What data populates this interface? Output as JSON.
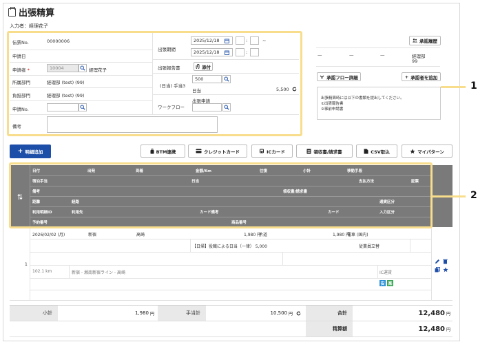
{
  "header": {
    "title": "出張精算",
    "inputter": "入力者：経理花子"
  },
  "form": {
    "denpyo_label": "伝票No.",
    "denpyo_value": "00000006",
    "shinseibi_label": "申請日",
    "shinseisha_label": "申請者",
    "shinseisha_code": "10004",
    "shinseisha_name": "経理花子",
    "shozoku_label": "所属部門",
    "shozoku_value": "経理部 (test) (99)",
    "futan_label": "負担部門",
    "futan_value": "経理部 (test) (99)",
    "shinsei_no_label": "申請No.",
    "biko_label": "備考",
    "kikan_label": "出張期間",
    "date_from": "2025/12/18",
    "date_to": "2025/12/18",
    "tilde": "~",
    "colon": ":",
    "houkokusho_label": "出張報告書",
    "attach_label": "添付",
    "teate_label": "(日当) 手当3",
    "teate_value": "500",
    "nitto_label": "日当",
    "nitto_amount": "5,500",
    "workflow_label": "ワークフロー",
    "workflow_value": "出張申請"
  },
  "approval": {
    "history_label": "承認履歴",
    "dash1": "—",
    "dash2": "—",
    "dash3": "—",
    "dept": "経理部",
    "dept_code": "99",
    "flow_detail_label": "承認フロー詳細",
    "add_approver_label": "承認者を追加",
    "notice_line1": "出張精算時には以下の書類を提出してください。",
    "notice_line2": "①出張報告書",
    "notice_line3": "②事前申請書"
  },
  "toolbar": {
    "add_detail": "明細追加",
    "btm": "BTM連携",
    "credit": "クレジットカード",
    "ic": "ICカード",
    "receipt": "領収書/請求書",
    "csv": "CSV取込",
    "mypattern": "マイパターン"
  },
  "grid_header": {
    "r1": [
      "日付",
      "出発",
      "到着",
      "金額/Km",
      "往復",
      "小計",
      "移動手段"
    ],
    "r2": [
      "宿泊手当",
      "日当",
      "支払方法",
      "証票"
    ],
    "r3": [
      "備考",
      "領収書/請求書"
    ],
    "r4": [
      "距離",
      "経路",
      "通貨区分"
    ],
    "r5": [
      "利用明細ID",
      "利用先",
      "カード備考",
      "カード",
      "入力区分"
    ],
    "r6": [
      "予約番号",
      "商品番号"
    ]
  },
  "row": {
    "index": "1",
    "date": "2026/02/02 (月)",
    "from": "新宿",
    "to": "高崎",
    "amount": "1,980 円",
    "roundtrip": "片道",
    "subtotal": "1,980 円",
    "transport": "電車 (国内)",
    "nitto_text": "【日帰】役職による日当（一律） 5,000",
    "payment": "従業員立替",
    "distance": "102.1 km",
    "route": "新宿 - 湘南新宿ライン - 高崎",
    "input_type": "IC運賃",
    "tag1": "安",
    "tag2": "楽"
  },
  "summary": {
    "subtotal_label": "小計",
    "subtotal_value": "1,980",
    "teate_label": "手当計",
    "teate_value": "10,500",
    "total_label": "合計",
    "total_value": "12,480",
    "seisan_label": "精算額",
    "seisan_value": "12,480",
    "yen": "円"
  },
  "callouts": {
    "one": "1",
    "two": "2"
  },
  "colors": {
    "highlight": "#f8dd8c",
    "primary": "#1e4fa8",
    "grid_header": "#7a7a7a",
    "tag_blue": "#2a8fd6",
    "tag_green": "#3aa655"
  }
}
